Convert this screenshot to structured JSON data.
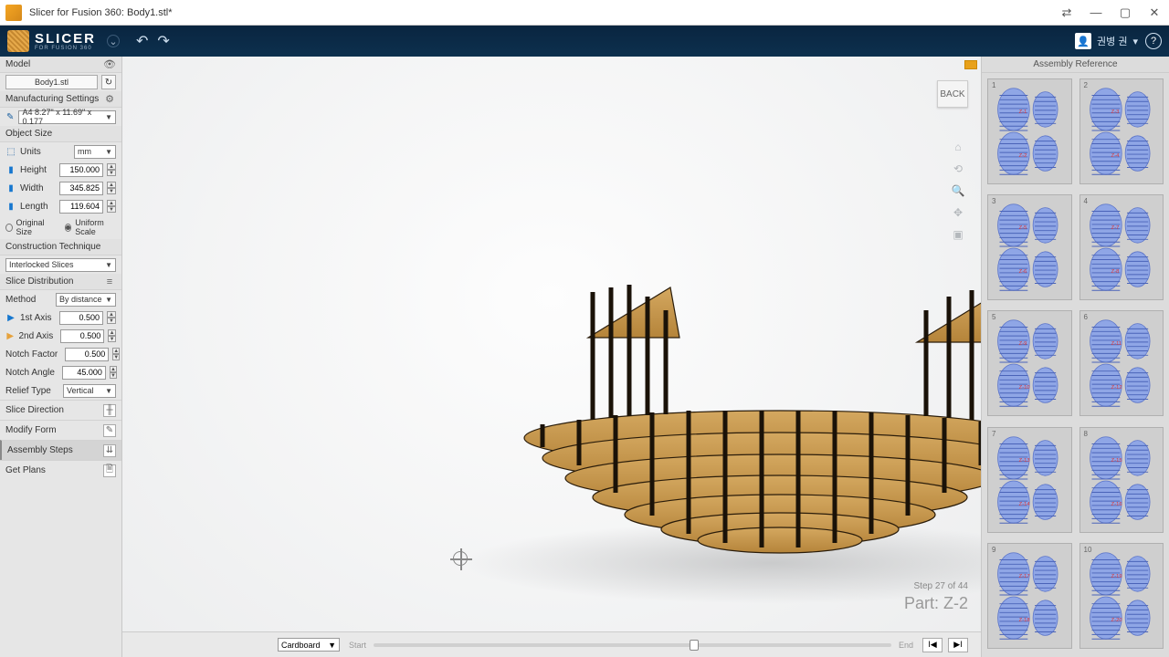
{
  "titlebar": {
    "title": "Slicer for Fusion 360: Body1.stl*"
  },
  "toolbar": {
    "app_name": "SLICER",
    "app_sub": "FOR FUSION 360",
    "user_name": "권병 권"
  },
  "sidebar": {
    "model_header": "Model",
    "model_name": "Body1.stl",
    "manuf_header": "Manufacturing Settings",
    "sheet_preset": "A4 8.27\" x 11.69\" x 0.177",
    "object_size_header": "Object Size",
    "units_label": "Units",
    "units_value": "mm",
    "height_label": "Height",
    "height_value": "150.000",
    "width_label": "Width",
    "width_value": "345.825",
    "length_label": "Length",
    "length_value": "119.604",
    "original_size": "Original Size",
    "uniform_scale": "Uniform Scale",
    "construction_header": "Construction Technique",
    "construction_value": "Interlocked Slices",
    "slice_dist_header": "Slice Distribution",
    "method_label": "Method",
    "method_value": "By distance",
    "axis1_label": "1st Axis",
    "axis1_value": "0.500",
    "axis2_label": "2nd Axis",
    "axis2_value": "0.500",
    "notch_factor_label": "Notch Factor",
    "notch_factor_value": "0.500",
    "notch_angle_label": "Notch Angle",
    "notch_angle_value": "45.000",
    "relief_label": "Relief Type",
    "relief_value": "Vertical",
    "slice_direction": "Slice Direction",
    "modify_form": "Modify Form",
    "assembly_steps": "Assembly Steps",
    "get_plans": "Get Plans"
  },
  "viewport": {
    "back": "BACK",
    "step_of": "Step 27 of 44",
    "part": "Part: Z-2"
  },
  "bottombar": {
    "material": "Cardboard",
    "start": "Start",
    "end": "End"
  },
  "rightpanel": {
    "title": "Assembly Reference",
    "sheets": [
      "1",
      "2",
      "3",
      "4",
      "5",
      "6",
      "7",
      "8",
      "9",
      "10"
    ]
  }
}
